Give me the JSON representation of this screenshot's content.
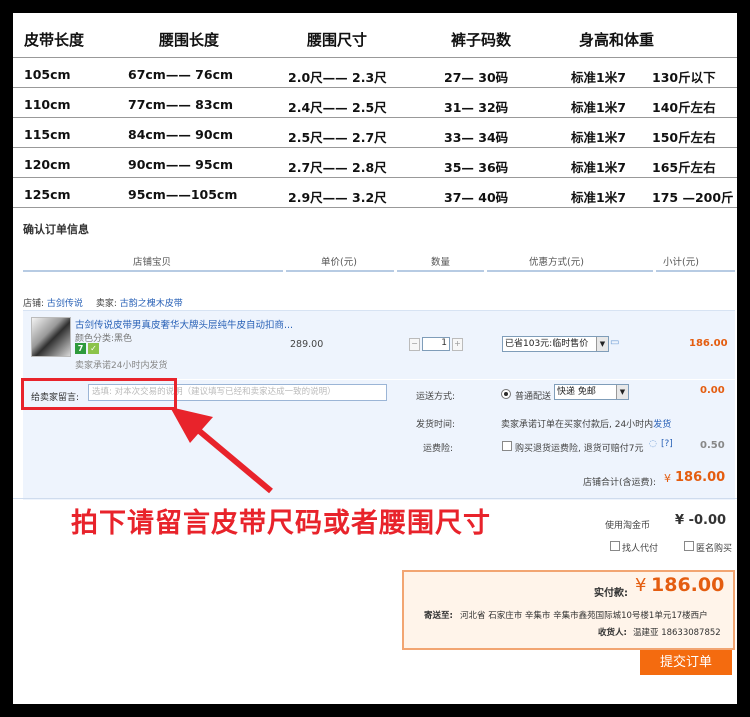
{
  "size_table": {
    "headers": [
      "皮带长度",
      "腰围长度",
      "腰围尺寸",
      "裤子码数",
      "身高和体重"
    ],
    "rows": [
      [
        "105cm",
        "67cm—— 76cm",
        "2.0尺—— 2.3尺",
        "27— 30码",
        "标准1米7",
        "130斤以下"
      ],
      [
        "110cm",
        "77cm—— 83cm",
        "2.4尺—— 2.5尺",
        "31— 32码",
        "标准1米7",
        "140斤左右"
      ],
      [
        "115cm",
        "84cm—— 90cm",
        "2.5尺—— 2.7尺",
        "33— 34码",
        "标准1米7",
        "150斤左右"
      ],
      [
        "120cm",
        "90cm—— 95cm",
        "2.7尺—— 2.8尺",
        "35— 36码",
        "标准1米7",
        "165斤左右"
      ],
      [
        "125cm",
        "95cm——105cm",
        "2.9尺—— 3.2尺",
        "37— 40码",
        "标准1米7",
        "175 —200斤"
      ]
    ]
  },
  "order": {
    "section_title": "确认订单信息",
    "columns": [
      "店铺宝贝",
      "单价(元)",
      "数量",
      "优惠方式(元)",
      "小计(元)"
    ],
    "shop_label": "店铺:",
    "shop_name": "古剑传说",
    "seller_label": "卖家:",
    "seller_name": "古韵之槐木皮带",
    "item": {
      "title": "古剑传说皮带男真皮奢华大牌头层纯牛皮自动扣商...",
      "attr": "颜色分类:黑色",
      "badge1": "7",
      "promise": "卖家承诺24小时内发货",
      "price": "289.00",
      "qty_minus": "−",
      "qty": "1",
      "qty_plus": "+",
      "discount": "已省103元:临时售价",
      "subtotal": "186.00"
    },
    "message": {
      "label": "给卖家留言:",
      "placeholder": "选填: 对本次交易的说明（建议填写已经和卖家达成一致的说明）"
    },
    "shipping": {
      "label": "运送方式:",
      "option": "普通配送",
      "select": "快递 免邮",
      "cost": "0.00"
    },
    "ship_time": {
      "label": "发货时间:",
      "text": "卖家承诺订单在买家付款后, 24小时内",
      "link": "发货"
    },
    "insurance": {
      "label": "运费险:",
      "text": "购买退货运费险, 退货可赔付7元",
      "help": "[?]",
      "cost": "0.50"
    },
    "store_total_label": "店铺合计(含运费):",
    "store_total_currency": "¥",
    "store_total": "186.00",
    "taojinbi_label": "使用淘金币",
    "taojinbi_value": "¥ -0.00",
    "proxy_pay": "找人代付",
    "anonymous": "匿名购买",
    "pay": {
      "label": "实付款:",
      "currency": "¥",
      "amount": "186.00",
      "address_label": "寄送至:",
      "address": "河北省 石家庄市 辛集市 辛集市鑫苑国际城10号楼1单元17楼西户",
      "receiver_label": "收货人:",
      "receiver": "温建亚 18633087852"
    },
    "submit": "提交订单"
  },
  "overlay_text": "拍下请留言皮带尺码或者腰围尺寸",
  "colors": {
    "accent_orange": "#f46b0f",
    "price_orange": "#e45d10",
    "annotation_red": "#e8232b",
    "link_blue": "#2a62b7",
    "row_bg": "#eef4fd"
  }
}
